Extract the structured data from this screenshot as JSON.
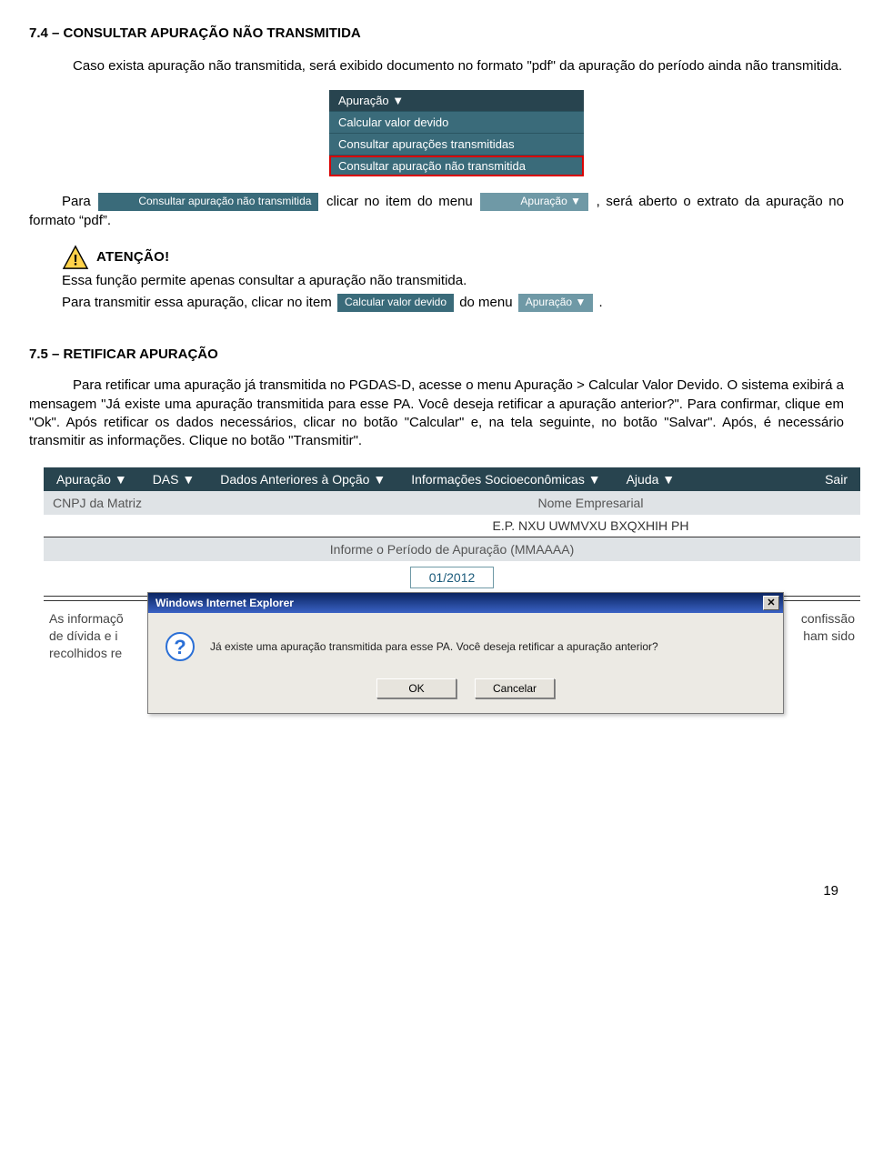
{
  "section74": {
    "title": "7.4 – CONSULTAR APURAÇÃO NÃO TRANSMITIDA",
    "intro": "Caso exista apuração não transmitida, será exibido documento no formato \"pdf\" da apuração do período ainda não transmitida.",
    "menu": {
      "items": [
        "Apuração ▼",
        "Calcular valor devido",
        "Consultar apurações transmitidas",
        "Consultar apuração não transmitida"
      ]
    },
    "para2_prefix": "Para ",
    "chip_consultar": "Consultar apuração não transmitida",
    "para2_mid1": " clicar no item do menu ",
    "chip_apuracao": "Apuração ▼",
    "para2_suffix": " , será aberto o extrato da apuração no formato “pdf”.",
    "warn_label": "ATENÇÃO!",
    "warn_line1": "Essa função permite apenas consultar a apuração não transmitida.",
    "warn_line2_prefix": "Para transmitir essa apuração, clicar no item ",
    "chip_calcular": "Calcular valor devido",
    "warn_line2_mid": " do menu ",
    "warn_line2_suffix": "."
  },
  "section75": {
    "title": "7.5 – RETIFICAR APURAÇÃO",
    "para": "Para retificar uma apuração já transmitida no PGDAS-D, acesse o menu Apuração > Calcular Valor Devido. O sistema exibirá a mensagem \"Já existe uma apuração transmitida para esse PA. Você deseja retificar a apuração anterior?\". Para confirmar, clique em \"Ok\". Após retificar os dados necessários, clicar no botão \"Calcular\" e, na tela seguinte, no botão \"Salvar\". Após, é necessário transmitir as informações. Clique no botão \"Transmitir\"."
  },
  "screenshot": {
    "menu": [
      "Apuração ▼",
      "DAS ▼",
      "Dados Anteriores à Opção ▼",
      "Informações Socioeconômicas ▼",
      "Ajuda ▼",
      "Sair"
    ],
    "col_cnpj": "CNPJ da Matriz",
    "col_nome": "Nome Empresarial",
    "nome_value": "E.P. NXU UWMVXU BXQXHIH PH",
    "periodo_label": "Informe o Período de Apuração (MMAAAA)",
    "periodo_value": "01/2012",
    "bg_left_l1": "As informaçõ",
    "bg_left_l2": "de dívida e i",
    "bg_left_l3": "recolhidos re",
    "bg_right_l1": "confissão",
    "bg_right_l2": "ham sido",
    "dialog": {
      "title": "Windows Internet Explorer",
      "message": "Já existe uma apuração transmitida para esse PA. Você deseja retificar a apuração anterior?",
      "ok": "OK",
      "cancel": "Cancelar",
      "close": "✕"
    }
  },
  "page_number": "19"
}
